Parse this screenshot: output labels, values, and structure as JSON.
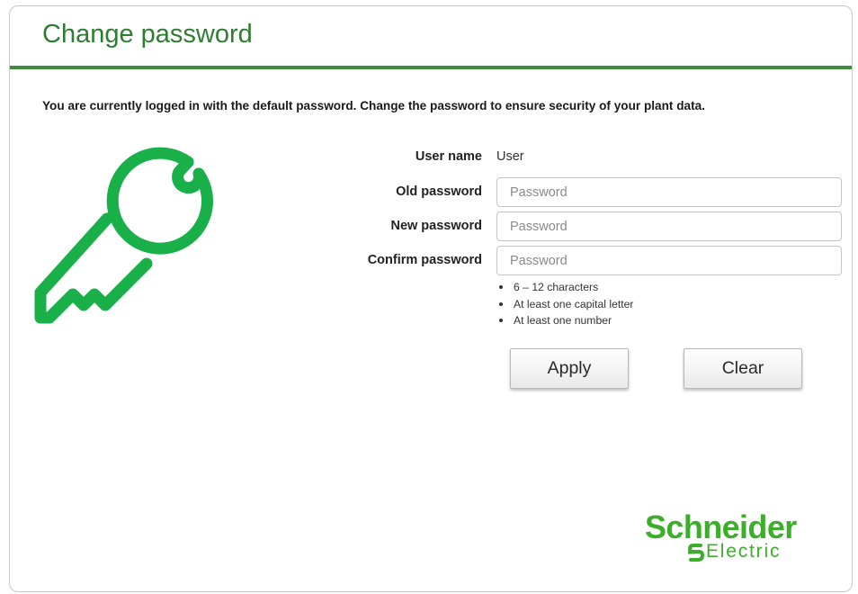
{
  "dialog": {
    "title": "Change password",
    "notice": "You are currently logged in with the default password. Change the password to ensure security of your plant data."
  },
  "form": {
    "user_name_label": "User name",
    "user_name_value": "User",
    "old_password_label": "Old password",
    "old_password_placeholder": "Password",
    "new_password_label": "New password",
    "new_password_placeholder": "Password",
    "confirm_password_label": "Confirm password",
    "confirm_password_placeholder": "Password",
    "rules": [
      "6 – 12 characters",
      "At least one capital letter",
      "At least one number"
    ]
  },
  "buttons": {
    "apply_label": "Apply",
    "clear_label": "Clear"
  },
  "logo": {
    "brand": "Schneider",
    "subtitle": "Electric"
  },
  "icons": {
    "key": "key-icon"
  },
  "colors": {
    "accent": "#3e8c40",
    "title": "#2e7d32",
    "brand_green": "#3dae2b",
    "key_green": "#19b04a"
  }
}
